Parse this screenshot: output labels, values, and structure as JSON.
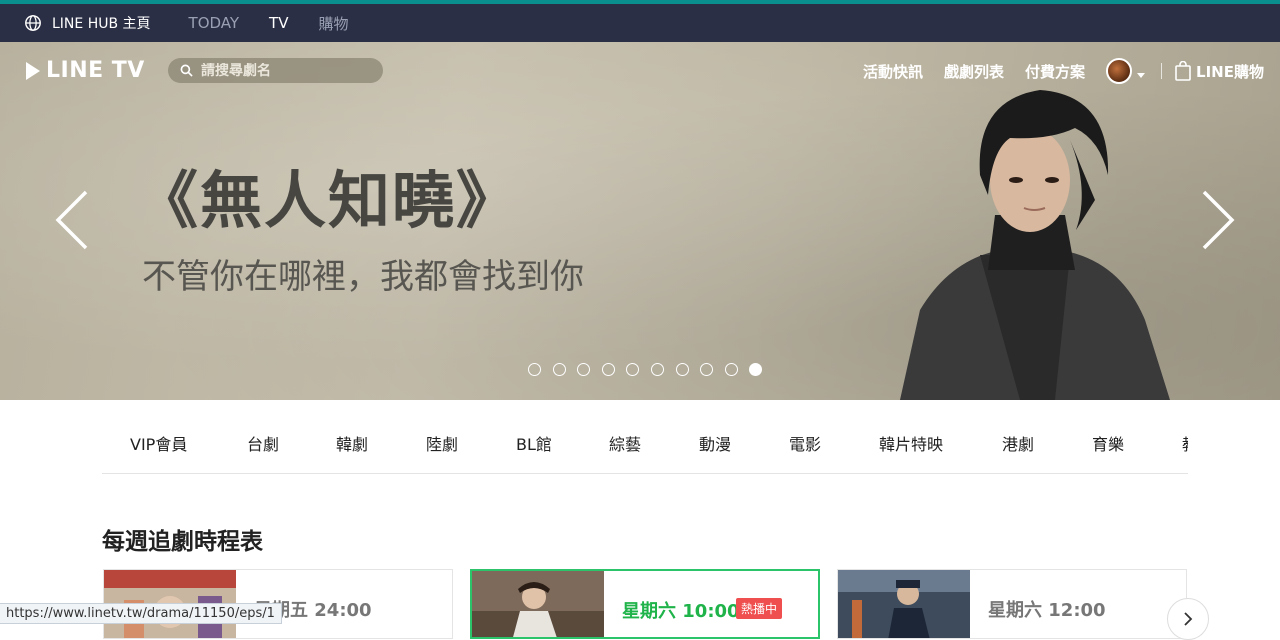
{
  "topbar": {
    "hub_label": "LINE HUB 主頁",
    "nav": [
      {
        "label": "TODAY",
        "active": false
      },
      {
        "label": "TV",
        "active": true
      },
      {
        "label": "購物",
        "active": false
      }
    ]
  },
  "header": {
    "logo_text": "LINE TV",
    "search_placeholder": "請搜尋劇名",
    "links": [
      "活動快訊",
      "戲劇列表",
      "付費方案"
    ],
    "shop_label": "LINE購物"
  },
  "hero": {
    "title": "《無人知曉》",
    "subtitle": "不管你在哪裡，我都會找到你",
    "slide_count": 10,
    "active_slide": 10
  },
  "categories": [
    "VIP會員",
    "台劇",
    "韓劇",
    "陸劇",
    "BL館",
    "綜藝",
    "動漫",
    "電影",
    "韓片特映",
    "港劇",
    "育樂",
    "教"
  ],
  "schedule": {
    "title": "每週追劇時程表",
    "cards": [
      {
        "time": "星期五 24:00",
        "active": false,
        "badge": ""
      },
      {
        "time": "星期六 10:00",
        "active": true,
        "badge": "熱播中"
      },
      {
        "time": "星期六 12:00",
        "active": false,
        "badge": ""
      }
    ]
  },
  "statusbar": {
    "url": "https://www.linetv.tw/drama/11150/eps/1"
  },
  "colors": {
    "topbar_bg": "#2b2f45",
    "accent_green": "#1fb34a",
    "badge_red": "#ef4f4f"
  }
}
